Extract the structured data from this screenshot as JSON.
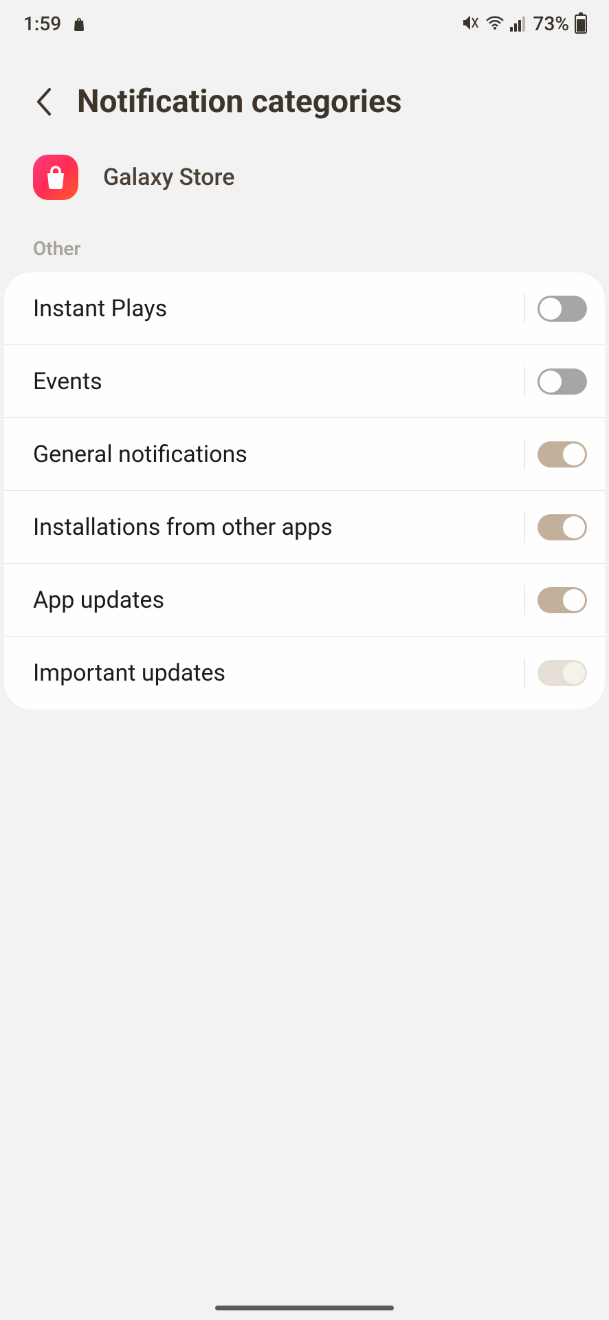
{
  "status": {
    "time": "1:59",
    "battery_pct": "73%"
  },
  "header": {
    "title": "Notification categories"
  },
  "app": {
    "name": "Galaxy Store"
  },
  "section_label": "Other",
  "rows": [
    {
      "label": "Instant Plays",
      "state": "off"
    },
    {
      "label": "Events",
      "state": "off"
    },
    {
      "label": "General notifications",
      "state": "on"
    },
    {
      "label": "Installations from other apps",
      "state": "on"
    },
    {
      "label": "App updates",
      "state": "on"
    },
    {
      "label": "Important updates",
      "state": "on-disabled"
    }
  ]
}
